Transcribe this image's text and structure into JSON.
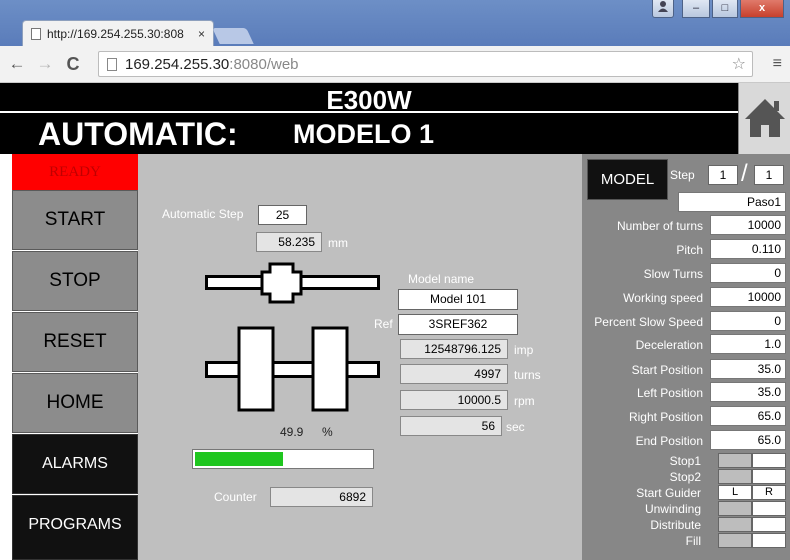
{
  "browser": {
    "tab_title": "http://169.254.255.30:808",
    "tab_close": "×",
    "url_host": "169.254.255.30",
    "url_path": ":8080/web",
    "window_buttons": [
      "–",
      "□",
      "x"
    ]
  },
  "header": {
    "machine": "E300W",
    "mode": "AUTOMATIC:",
    "model": "MODELO 1"
  },
  "nav": {
    "status": "READY",
    "buttons": [
      "START",
      "STOP",
      "RESET",
      "HOME",
      "ALARMS",
      "PROGRAMS"
    ]
  },
  "center": {
    "automatic_step_label": "Automatic Step",
    "automatic_step": "25",
    "position": "58.235",
    "position_unit": "mm",
    "model_name_label": "Model name",
    "model_name": "Model 101",
    "ref_label": "Ref",
    "ref": "3SREF362",
    "readouts": [
      {
        "value": "12548796.125",
        "unit": "imp"
      },
      {
        "value": "4997",
        "unit": "turns"
      },
      {
        "value": "10000.5",
        "unit": "rpm"
      },
      {
        "value": "56",
        "unit": "sec"
      }
    ],
    "progress_value": "49.9",
    "progress_unit": "%",
    "progress_fraction": 0.499,
    "counter_label": "Counter",
    "counter": "6892"
  },
  "right": {
    "model_button": "MODEL",
    "step_label": "Step",
    "step_current": "1",
    "step_separator": "/",
    "step_total": "1",
    "step_name": "Paso1",
    "params": [
      {
        "label": "Number of turns",
        "value": "10000"
      },
      {
        "label": "Pitch",
        "value": "0.110"
      },
      {
        "label": "Slow Turns",
        "value": "0"
      },
      {
        "label": "Working speed",
        "value": "10000"
      },
      {
        "label": "Percent Slow Speed",
        "value": "0"
      },
      {
        "label": "Deceleration",
        "value": "1.0"
      },
      {
        "label": "Start Position",
        "value": "35.0"
      },
      {
        "label": "Left Position",
        "value": "35.0"
      },
      {
        "label": "Right Position",
        "value": "65.0"
      },
      {
        "label": "End Position",
        "value": "65.0"
      }
    ],
    "indicators": [
      {
        "label": "Stop1",
        "left": "",
        "right": "",
        "left_on": false,
        "right_on": true
      },
      {
        "label": "Stop2",
        "left": "",
        "right": "",
        "left_on": false,
        "right_on": true
      },
      {
        "label": "Start Guider",
        "left": "L",
        "right": "R",
        "left_on": true,
        "right_on": true
      },
      {
        "label": "Unwinding",
        "left": "",
        "right": "",
        "left_on": false,
        "right_on": true
      },
      {
        "label": "Distribute",
        "left": "",
        "right": "",
        "left_on": false,
        "right_on": true
      },
      {
        "label": "Fill",
        "left": "",
        "right": "",
        "left_on": false,
        "right_on": true
      }
    ]
  },
  "colors": {
    "ready": "#ff0000",
    "progress": "#1fc61f",
    "panel_center": "#bfbfbf",
    "panel_right": "#878787"
  }
}
